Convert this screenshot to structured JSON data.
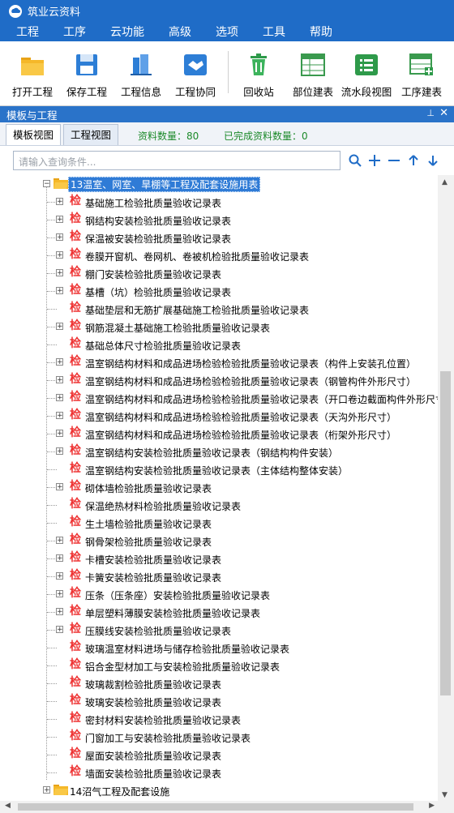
{
  "app": {
    "title": "筑业云资料"
  },
  "menu": [
    "工程",
    "工序",
    "云功能",
    "高级",
    "选项",
    "工具",
    "帮助"
  ],
  "toolbar": [
    {
      "label": "打开工程",
      "icon": "folder-open-icon"
    },
    {
      "label": "保存工程",
      "icon": "save-icon"
    },
    {
      "label": "工程信息",
      "icon": "building-icon"
    },
    {
      "label": "工程协同",
      "icon": "handshake-icon"
    },
    {
      "label": "回收站",
      "icon": "recycle-bin-icon"
    },
    {
      "label": "部位建表",
      "icon": "table-part-icon"
    },
    {
      "label": "流水段视图",
      "icon": "list-view-icon"
    },
    {
      "label": "工序建表",
      "icon": "table-process-icon"
    }
  ],
  "panel": {
    "title": "模板与工程",
    "pin": "⊥",
    "close": "✕"
  },
  "tabs": {
    "template_view": "模板视图",
    "project_view": "工程视图"
  },
  "counts": {
    "total": "资料数量：80",
    "done": "已完成资料数量：0"
  },
  "search": {
    "placeholder": "请输入查询条件..."
  },
  "tree": {
    "parent": "13温室、网室、旱棚等工程及配套设施用表",
    "items": [
      {
        "label": "基础施工检验批质量验收记录表",
        "exp": true
      },
      {
        "label": "钢结构安装检验批质量验收记录表",
        "exp": true
      },
      {
        "label": "保温被安装检验批质量验收记录表",
        "exp": true
      },
      {
        "label": "卷膜开窗机、卷网机、卷被机检验批质量验收记录表",
        "exp": true
      },
      {
        "label": "棚门安装检验批质量验收记录表",
        "exp": true
      },
      {
        "label": "基槽（坑）检验批质量验收记录表",
        "exp": true
      },
      {
        "label": "基础垫层和无筋扩展基础施工检验批质量验收记录表",
        "exp": false
      },
      {
        "label": "钢筋混凝土基础施工检验批质量验收记录表",
        "exp": true
      },
      {
        "label": "基础总体尺寸检验批质量验收记录表",
        "exp": false
      },
      {
        "label": "温室钢结构材料和成品进场检验检验批质量验收记录表（构件上安装孔位置）",
        "exp": true
      },
      {
        "label": "温室钢结构材料和成品进场检验检验批质量验收记录表（钢管构件外形尺寸）",
        "exp": true
      },
      {
        "label": "温室钢结构材料和成品进场检验检验批质量验收记录表（开口卷边截面构件外形尺寸）",
        "exp": true
      },
      {
        "label": "温室钢结构材料和成品进场检验检验批质量验收记录表（天沟外形尺寸）",
        "exp": true
      },
      {
        "label": "温室钢结构材料和成品进场检验检验批质量验收记录表（桁架外形尺寸）",
        "exp": true
      },
      {
        "label": "温室钢结构安装检验批质量验收记录表（钢结构构件安装）",
        "exp": true
      },
      {
        "label": "温室钢结构安装检验批质量验收记录表（主体结构整体安装）",
        "exp": false
      },
      {
        "label": "砌体墙检验批质量验收记录表",
        "exp": true
      },
      {
        "label": "保温绝热材料检验批质量验收记录表",
        "exp": false
      },
      {
        "label": "生土墙检验批质量验收记录表",
        "exp": false
      },
      {
        "label": "钢骨架检验批质量验收记录表",
        "exp": true
      },
      {
        "label": "卡槽安装检验批质量验收记录表",
        "exp": true
      },
      {
        "label": "卡簧安装检验批质量验收记录表",
        "exp": true
      },
      {
        "label": "压条（压条座）安装检验批质量验收记录表",
        "exp": true
      },
      {
        "label": "单层塑料薄膜安装检验批质量验收记录表",
        "exp": true
      },
      {
        "label": "压膜线安装检验批质量验收记录表",
        "exp": true
      },
      {
        "label": "玻璃温室材料进场与储存检验批质量验收记录表",
        "exp": false
      },
      {
        "label": "铝合金型材加工与安装检验批质量验收记录表",
        "exp": false
      },
      {
        "label": "玻璃裁割检验批质量验收记录表",
        "exp": false
      },
      {
        "label": "玻璃安装检验批质量验收记录表",
        "exp": false
      },
      {
        "label": "密封材料安装检验批质量验收记录表",
        "exp": false
      },
      {
        "label": "门窗加工与安装检验批质量验收记录表",
        "exp": false
      },
      {
        "label": "屋面安装检验批质量验收记录表",
        "exp": false
      },
      {
        "label": "墙面安装检验批质量验收记录表",
        "exp": false
      }
    ],
    "next_parent": "14沼气工程及配套设施",
    "jian": "检",
    "expand_minus": "−",
    "expand_plus": "+"
  }
}
